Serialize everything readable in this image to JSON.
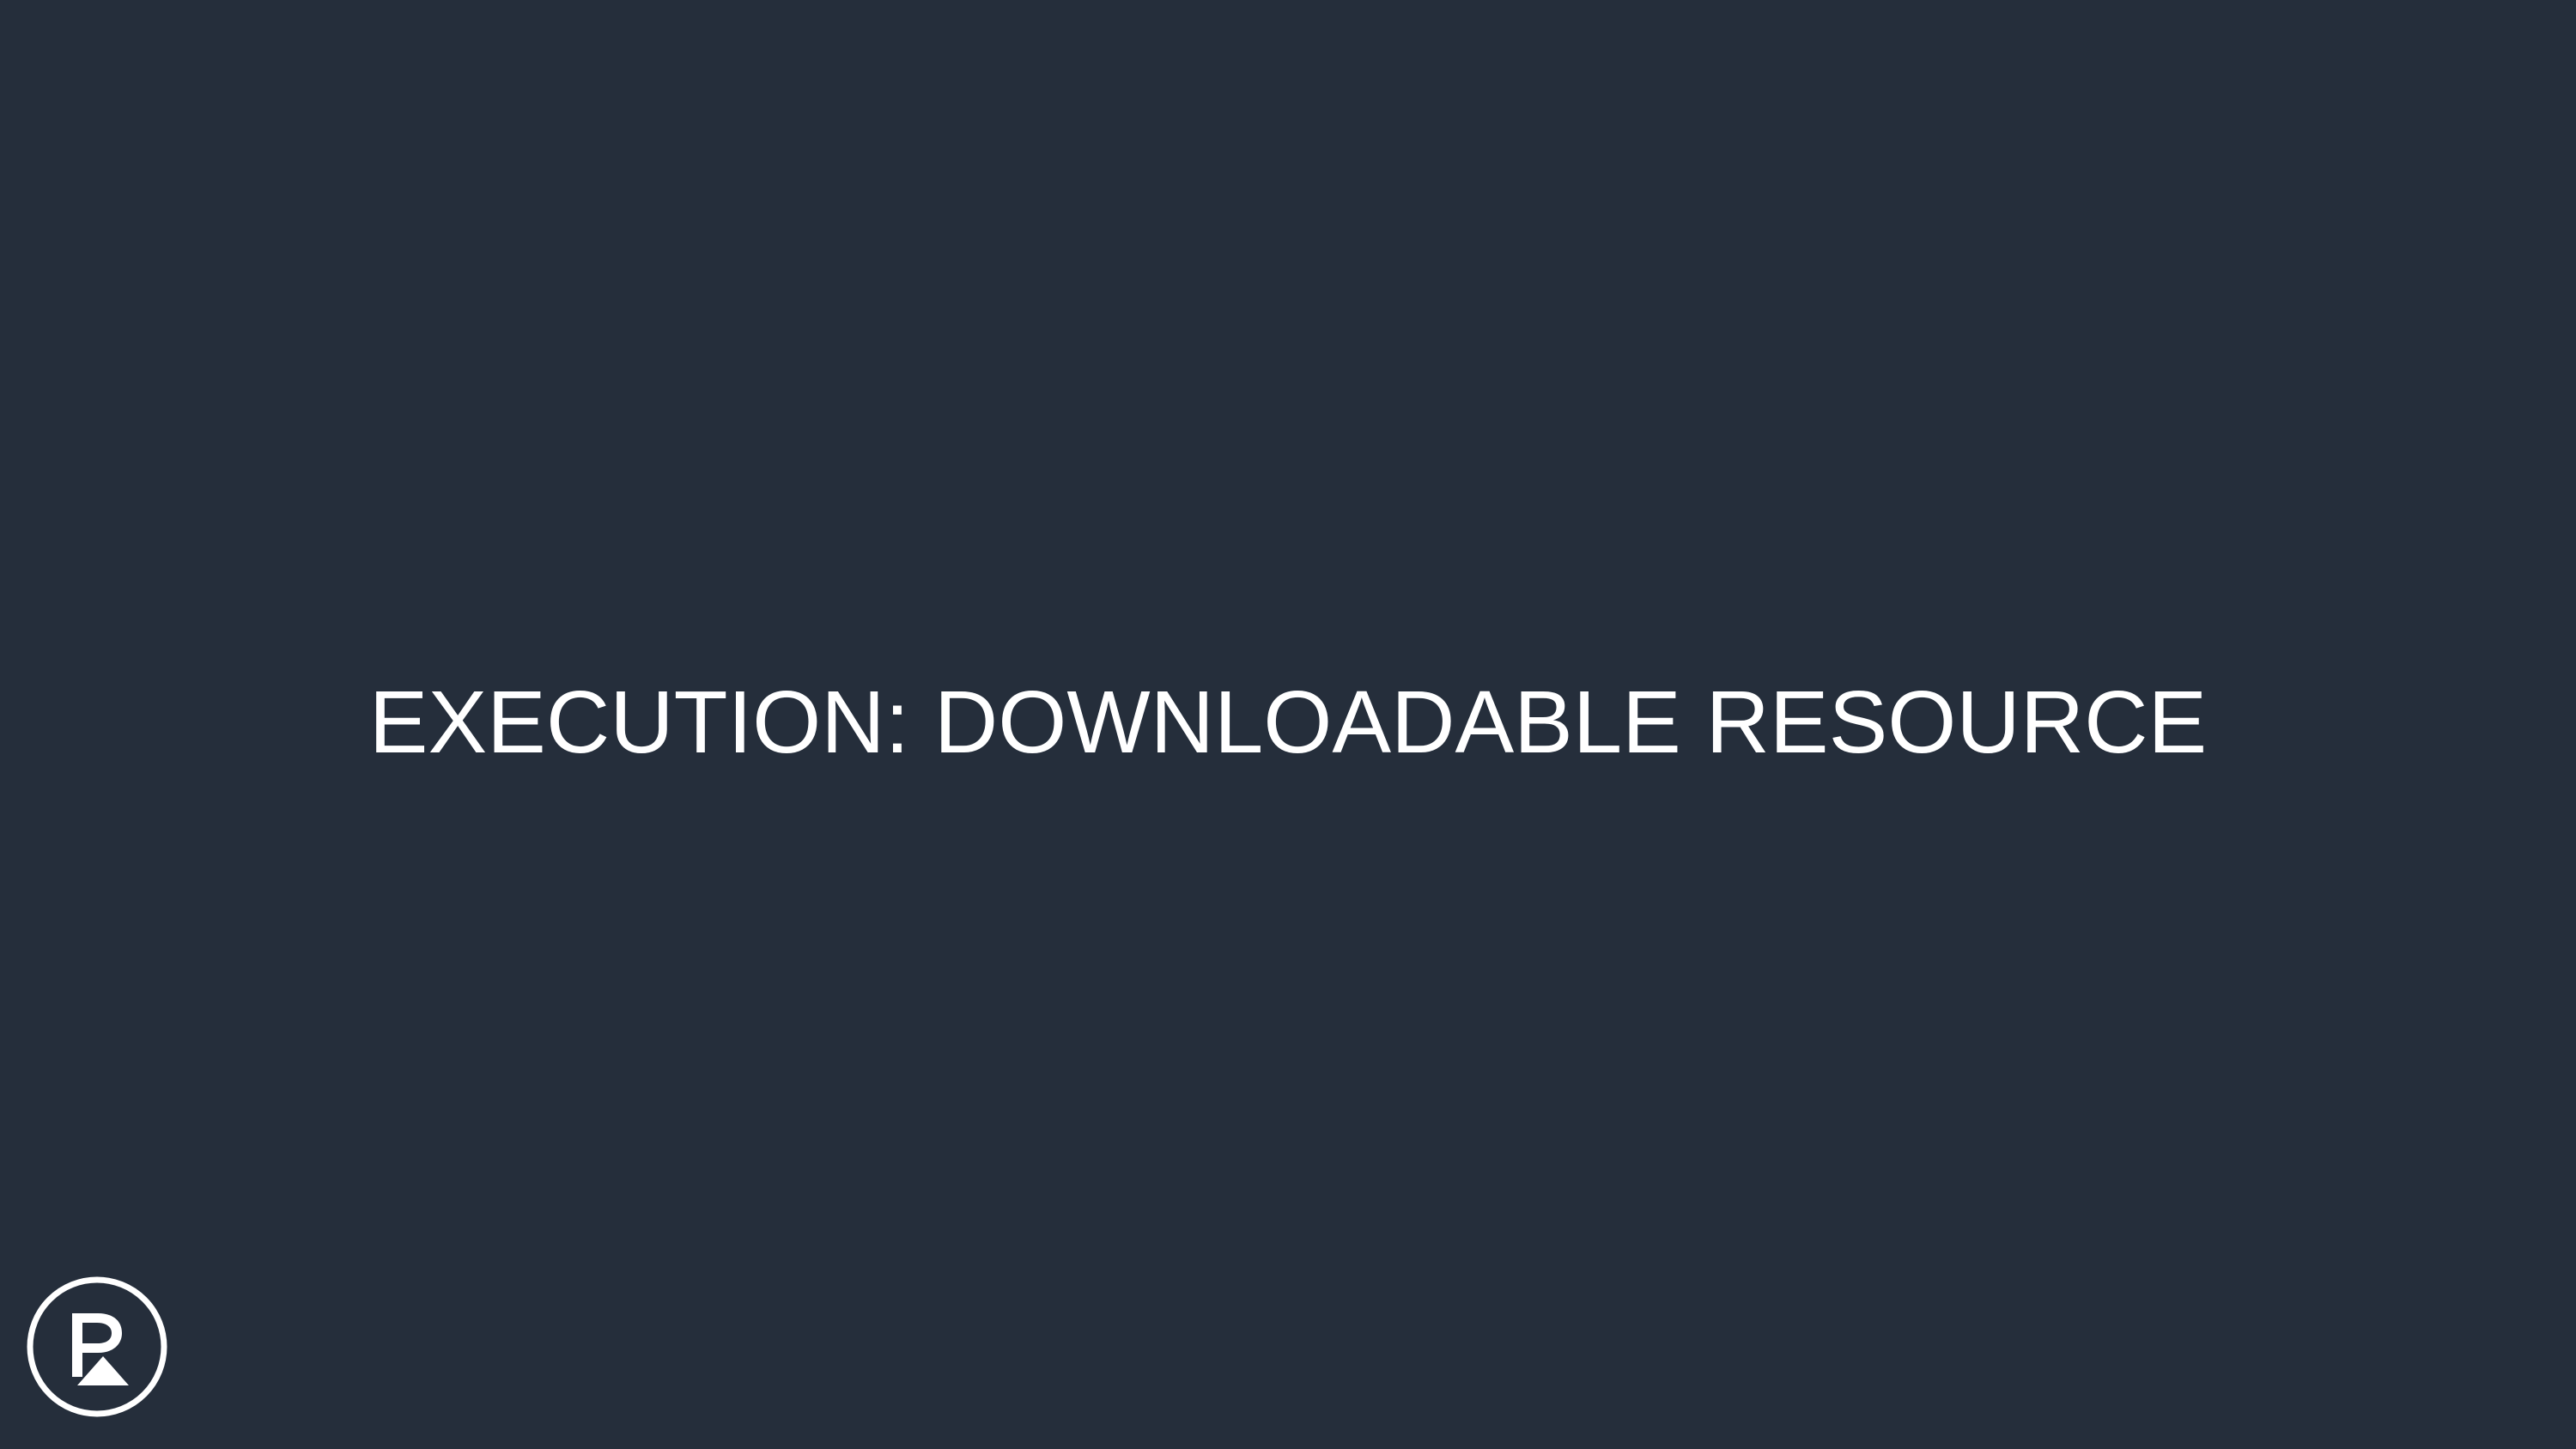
{
  "slide": {
    "title": "EXECUTION: DOWNLOADABLE RESOURCE",
    "background_color": "#252e3b",
    "text_color": "#ffffff"
  },
  "logo": {
    "icon": "brand-logo-icon",
    "color": "#ffffff"
  }
}
